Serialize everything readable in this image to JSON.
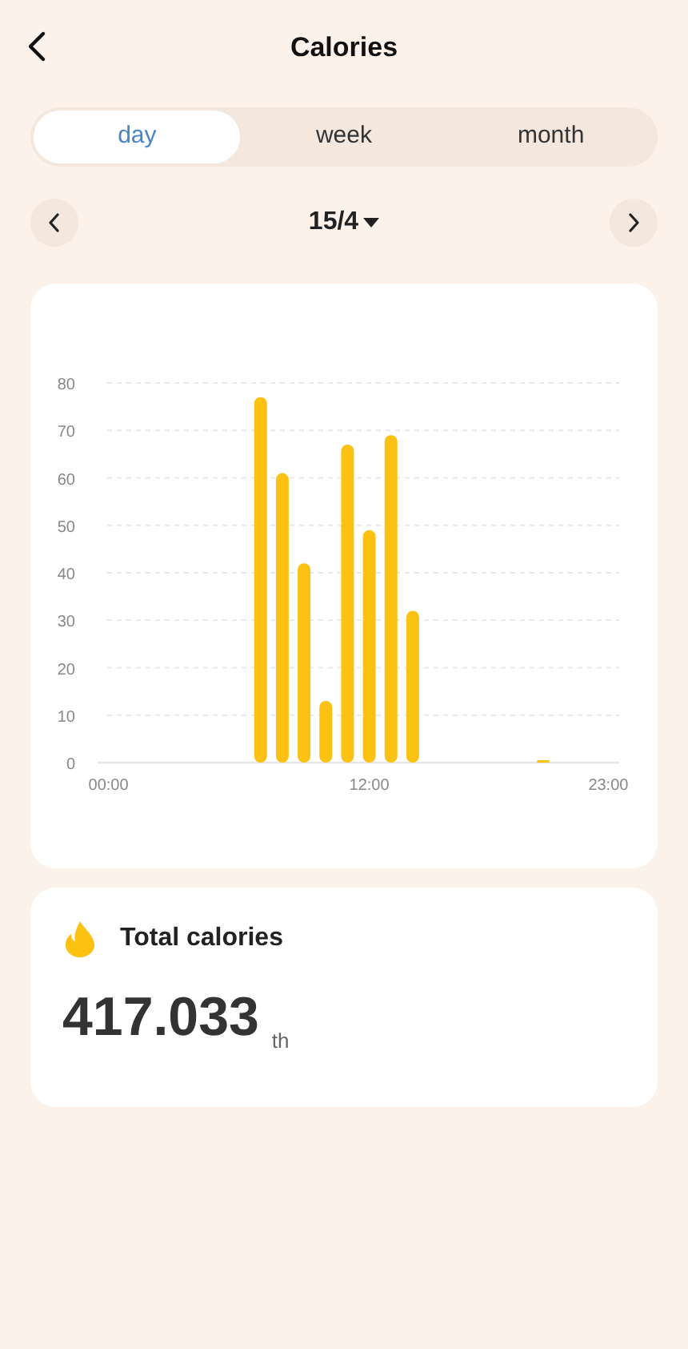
{
  "header": {
    "title": "Calories"
  },
  "tabs": [
    {
      "label": "day",
      "selected": true
    },
    {
      "label": "week",
      "selected": false
    },
    {
      "label": "month",
      "selected": false
    }
  ],
  "date_nav": {
    "date": "15/4"
  },
  "chart": {
    "chart_data": {
      "type": "bar",
      "x": [
        0,
        1,
        2,
        3,
        4,
        5,
        6,
        7,
        8,
        9,
        10,
        11,
        12,
        13,
        14,
        15,
        16,
        17,
        18,
        19,
        20,
        21,
        22,
        23
      ],
      "series": [
        {
          "color": "#fbc214",
          "values": [
            0,
            0,
            0,
            0,
            0,
            0,
            0,
            77,
            61,
            42,
            13,
            67,
            49,
            69,
            32,
            0,
            0,
            0,
            0,
            0,
            0.3,
            0,
            0,
            0
          ]
        }
      ],
      "xlim": [
        -0.5,
        23.5
      ],
      "ylim": [
        0,
        80
      ],
      "grid": true,
      "yticks": [
        0,
        10,
        20,
        30,
        40,
        50,
        60,
        70,
        80
      ],
      "xticks": [
        {
          "value": 0,
          "label": "00:00"
        },
        {
          "value": 12,
          "label": "12:00"
        },
        {
          "value": 23,
          "label": "23:00"
        }
      ]
    }
  },
  "total": {
    "label": "Total calories",
    "value": "417.033",
    "unit": "th"
  }
}
